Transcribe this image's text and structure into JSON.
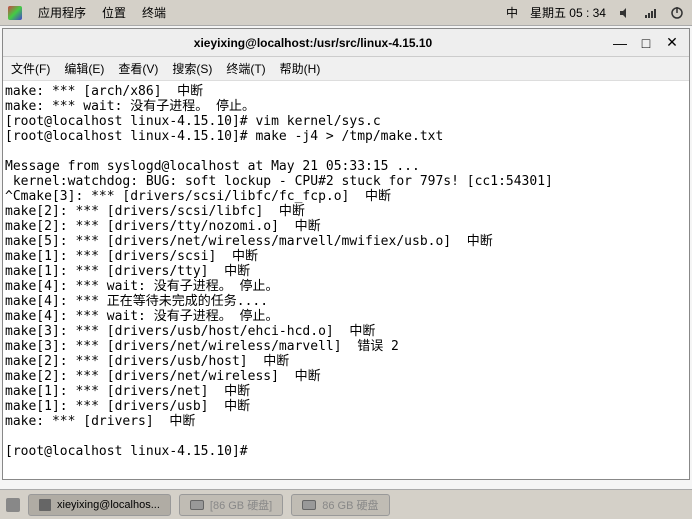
{
  "panel": {
    "apps": "应用程序",
    "places": "位置",
    "terminal": "终端",
    "ime": "中",
    "datetime": "星期五 05 : 34"
  },
  "window": {
    "title": "xieyixing@localhost:/usr/src/linux-4.15.10"
  },
  "menubar": {
    "file": "文件(F)",
    "edit": "编辑(E)",
    "view": "查看(V)",
    "search": "搜索(S)",
    "terminal": "终端(T)",
    "help": "帮助(H)"
  },
  "terminal": {
    "lines": [
      "make: *** [arch/x86]  中断",
      "make: *** wait: 没有子进程。 停止。",
      "[root@localhost linux-4.15.10]# vim kernel/sys.c",
      "[root@localhost linux-4.15.10]# make -j4 > /tmp/make.txt",
      "",
      "Message from syslogd@localhost at May 21 05:33:15 ...",
      " kernel:watchdog: BUG: soft lockup - CPU#2 stuck for 797s! [cc1:54301]",
      "^Cmake[3]: *** [drivers/scsi/libfc/fc_fcp.o]  中断",
      "make[2]: *** [drivers/scsi/libfc]  中断",
      "make[2]: *** [drivers/tty/nozomi.o]  中断",
      "make[5]: *** [drivers/net/wireless/marvell/mwifiex/usb.o]  中断",
      "make[1]: *** [drivers/scsi]  中断",
      "make[1]: *** [drivers/tty]  中断",
      "make[4]: *** wait: 没有子进程。 停止。",
      "make[4]: *** 正在等待未完成的任务....",
      "make[4]: *** wait: 没有子进程。 停止。",
      "make[3]: *** [drivers/usb/host/ehci-hcd.o]  中断",
      "make[3]: *** [drivers/net/wireless/marvell]  错误 2",
      "make[2]: *** [drivers/usb/host]  中断",
      "make[2]: *** [drivers/net/wireless]  中断",
      "make[1]: *** [drivers/net]  中断",
      "make[1]: *** [drivers/usb]  中断",
      "make: *** [drivers]  中断",
      "",
      "[root@localhost linux-4.15.10]# "
    ]
  },
  "taskbar": {
    "task1": "xieyixing@localhos...",
    "task2": "[86 GB 硬盘]",
    "task3": "86 GB 硬盘"
  }
}
